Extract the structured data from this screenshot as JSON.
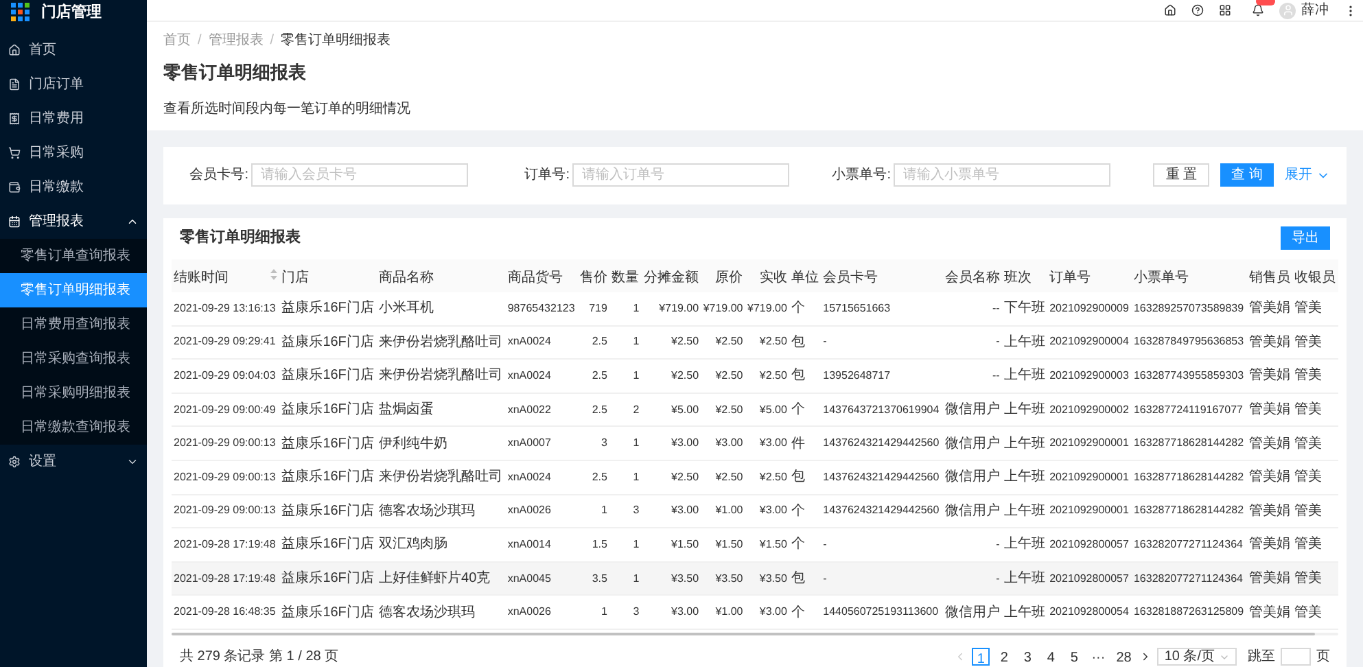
{
  "app": {
    "title": "门店管理"
  },
  "sidebar": {
    "items": [
      {
        "label": "首页"
      },
      {
        "label": "门店订单"
      },
      {
        "label": "日常费用"
      },
      {
        "label": "日常采购"
      },
      {
        "label": "日常缴款"
      },
      {
        "label": "管理报表",
        "expanded": true,
        "children": [
          {
            "label": "零售订单查询报表",
            "selected": false
          },
          {
            "label": "零售订单明细报表",
            "selected": true
          },
          {
            "label": "日常费用查询报表",
            "selected": false
          },
          {
            "label": "日常采购查询报表",
            "selected": false
          },
          {
            "label": "日常采购明细报表",
            "selected": false
          },
          {
            "label": "日常缴款查询报表",
            "selected": false
          }
        ]
      },
      {
        "label": "设置",
        "expanded": false
      }
    ]
  },
  "topbar": {
    "user": "薛冲",
    "notification_badge": true
  },
  "breadcrumb": {
    "separator": "/",
    "items": [
      "首页",
      "管理报表",
      "零售订单明细报表"
    ]
  },
  "page": {
    "title": "零售订单明细报表",
    "description": "查看所选时间段内每一笔订单的明细情况"
  },
  "filters": [
    {
      "label": "会员卡号:",
      "placeholder": "请输入会员卡号"
    },
    {
      "label": "订单号:",
      "placeholder": "请输入订单号"
    },
    {
      "label": "小票单号:",
      "placeholder": "请输入小票单号"
    }
  ],
  "filter_buttons": {
    "reset": "重 置",
    "search": "查 询",
    "expand": "展开"
  },
  "table": {
    "title": "零售订单明细报表",
    "export": "导出",
    "columns": [
      {
        "label": "结账时间",
        "sortable": true
      },
      {
        "label": "门店"
      },
      {
        "label": "商品名称"
      },
      {
        "label": "商品货号"
      },
      {
        "label": "售价"
      },
      {
        "label": "数量"
      },
      {
        "label": "分摊金额"
      },
      {
        "label": "原价"
      },
      {
        "label": "实收"
      },
      {
        "label": "单位"
      },
      {
        "label": "会员卡号"
      },
      {
        "label": "会员名称"
      },
      {
        "label": "班次"
      },
      {
        "label": "订单号"
      },
      {
        "label": "小票单号"
      },
      {
        "label": "销售员"
      },
      {
        "label": "收银员"
      }
    ],
    "rows": [
      {
        "hovered": false,
        "cells": [
          "2021-09-29 13:16:13",
          "益康乐16F门店",
          "小米耳机",
          "98765432123",
          "719",
          "1",
          "¥719.00",
          "¥719.00",
          "¥719.00",
          "个",
          "15715651663",
          "--",
          "下午班",
          "2021092900009",
          "163289257073589839",
          "管美娟",
          "管美"
        ]
      },
      {
        "hovered": false,
        "cells": [
          "2021-09-29 09:29:41",
          "益康乐16F门店",
          "来伊份岩烧乳酪吐司",
          "xnA0024",
          "2.5",
          "1",
          "¥2.50",
          "¥2.50",
          "¥2.50",
          "包",
          "-",
          "-",
          "上午班",
          "2021092900004",
          "163287849795636853",
          "管美娟",
          "管美"
        ]
      },
      {
        "hovered": false,
        "cells": [
          "2021-09-29 09:04:03",
          "益康乐16F门店",
          "来伊份岩烧乳酪吐司",
          "xnA0024",
          "2.5",
          "1",
          "¥2.50",
          "¥2.50",
          "¥2.50",
          "包",
          "13952648717",
          "--",
          "上午班",
          "2021092900003",
          "163287743955859303",
          "管美娟",
          "管美"
        ]
      },
      {
        "hovered": false,
        "cells": [
          "2021-09-29 09:00:49",
          "益康乐16F门店",
          "盐焗卤蛋",
          "xnA0022",
          "2.5",
          "2",
          "¥5.00",
          "¥2.50",
          "¥5.00",
          "个",
          "1437643721370619904",
          "微信用户",
          "上午班",
          "2021092900002",
          "163287724119167077",
          "管美娟",
          "管美"
        ]
      },
      {
        "hovered": false,
        "cells": [
          "2021-09-29 09:00:13",
          "益康乐16F门店",
          "伊利纯牛奶",
          "xnA0007",
          "3",
          "1",
          "¥3.00",
          "¥3.00",
          "¥3.00",
          "件",
          "1437624321429442560",
          "微信用户",
          "上午班",
          "2021092900001",
          "163287718628144282",
          "管美娟",
          "管美"
        ]
      },
      {
        "hovered": false,
        "cells": [
          "2021-09-29 09:00:13",
          "益康乐16F门店",
          "来伊份岩烧乳酪吐司",
          "xnA0024",
          "2.5",
          "1",
          "¥2.50",
          "¥2.50",
          "¥2.50",
          "包",
          "1437624321429442560",
          "微信用户",
          "上午班",
          "2021092900001",
          "163287718628144282",
          "管美娟",
          "管美"
        ]
      },
      {
        "hovered": false,
        "cells": [
          "2021-09-29 09:00:13",
          "益康乐16F门店",
          "德客农场沙琪玛",
          "xnA0026",
          "1",
          "3",
          "¥3.00",
          "¥1.00",
          "¥3.00",
          "个",
          "1437624321429442560",
          "微信用户",
          "上午班",
          "2021092900001",
          "163287718628144282",
          "管美娟",
          "管美"
        ]
      },
      {
        "hovered": false,
        "cells": [
          "2021-09-28 17:19:48",
          "益康乐16F门店",
          "双汇鸡肉肠",
          "xnA0014",
          "1.5",
          "1",
          "¥1.50",
          "¥1.50",
          "¥1.50",
          "个",
          "-",
          "-",
          "上午班",
          "2021092800057",
          "163282077271124364",
          "管美娟",
          "管美"
        ]
      },
      {
        "hovered": true,
        "cells": [
          "2021-09-28 17:19:48",
          "益康乐16F门店",
          "上好佳鲜虾片40克",
          "xnA0045",
          "3.5",
          "1",
          "¥3.50",
          "¥3.50",
          "¥3.50",
          "包",
          "-",
          "-",
          "上午班",
          "2021092800057",
          "163282077271124364",
          "管美娟",
          "管美"
        ]
      },
      {
        "hovered": false,
        "cells": [
          "2021-09-28 16:48:35",
          "益康乐16F门店",
          "德客农场沙琪玛",
          "xnA0026",
          "1",
          "3",
          "¥3.00",
          "¥1.00",
          "¥3.00",
          "个",
          "1440560725193113600",
          "微信用户",
          "上午班",
          "2021092800054",
          "163281887263125809",
          "管美娟",
          "管美"
        ]
      }
    ]
  },
  "pagination": {
    "summary": "共 279 条记录 第 1 / 28 页",
    "pages": [
      {
        "label": "1",
        "selected": true
      },
      {
        "label": "2",
        "selected": false
      },
      {
        "label": "3",
        "selected": false
      },
      {
        "label": "4",
        "selected": false
      },
      {
        "label": "5",
        "selected": false
      },
      {
        "label": "···",
        "selected": false
      },
      {
        "label": "28",
        "selected": false
      }
    ],
    "page_size": "10 条/页",
    "jump_label": "跳至",
    "jump_suffix": "页"
  }
}
